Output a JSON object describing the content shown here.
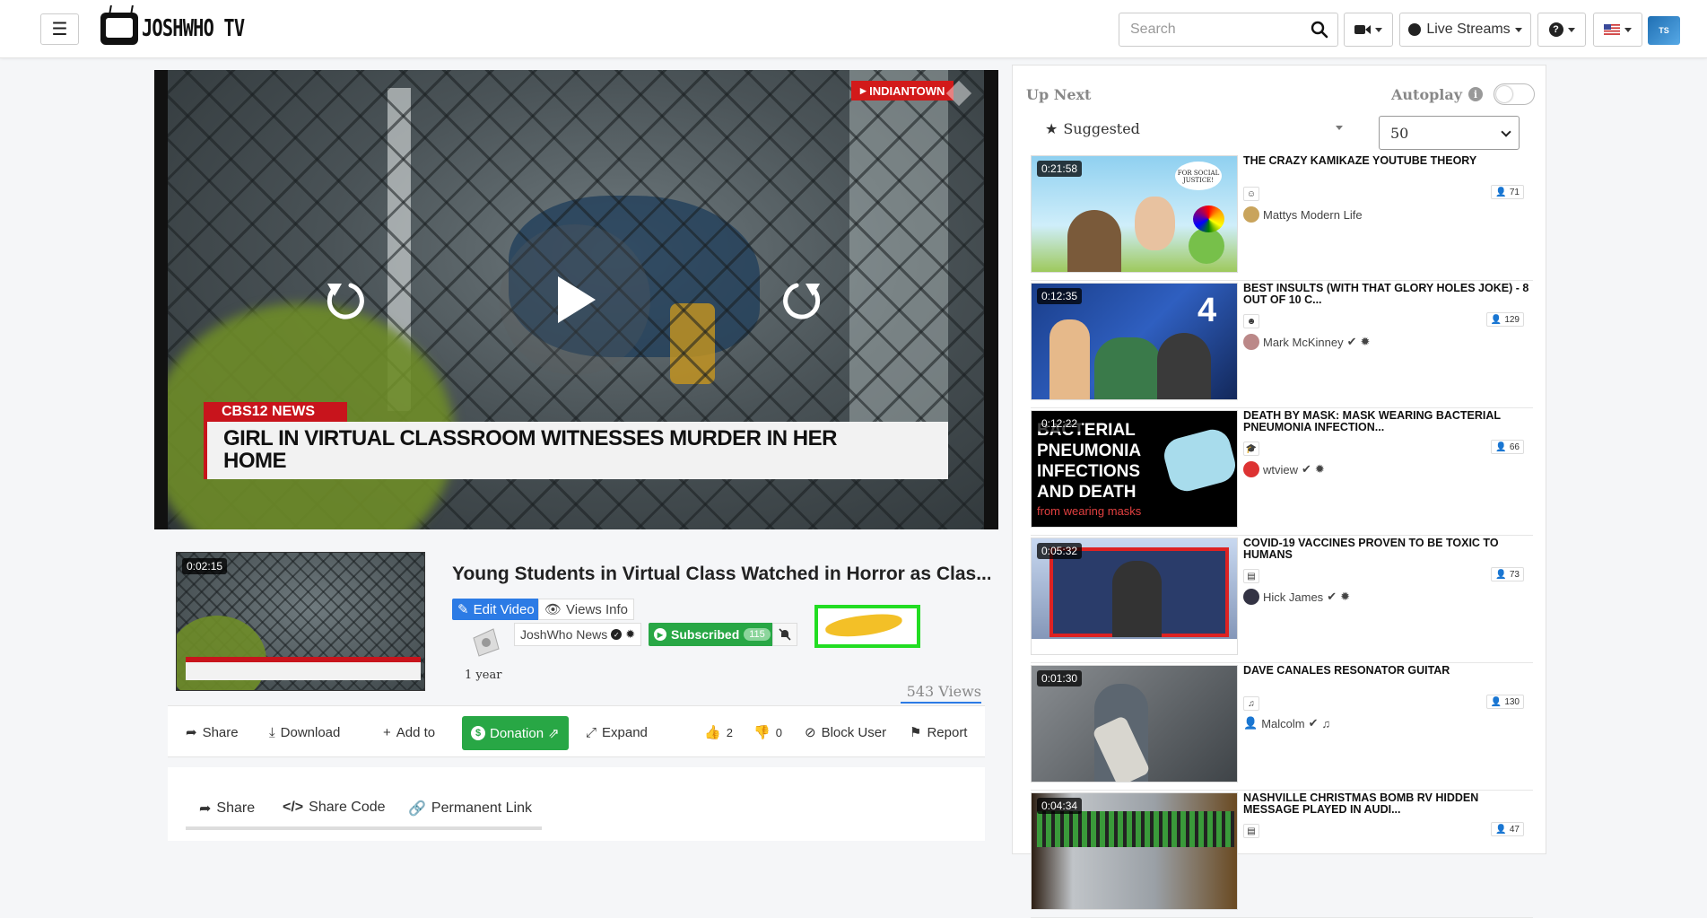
{
  "nav": {
    "search_placeholder": "Search",
    "live_streams": "Live Streams",
    "logo_text": "JOSHWHO TV"
  },
  "player": {
    "overlay_tag": "INDIANTOWN",
    "lower_third_brand": "CBS12 NEWS",
    "lower_third_headline": "GIRL IN VIRTUAL CLASSROOM WITNESSES MURDER IN HER HOME"
  },
  "video": {
    "duration": "0:02:15",
    "title": "Young Students in Virtual Class Watched in Horror as Clas...",
    "edit_label": "Edit Video",
    "views_info_label": "Views Info",
    "channel": "JoshWho News",
    "subscribed_label": "Subscribed",
    "subscriber_count": "115",
    "age": "1 year",
    "views": "543 Views"
  },
  "actions": {
    "share": "Share",
    "download": "Download",
    "add_to": "Add to",
    "donation": "Donation",
    "expand": "Expand",
    "likes": "2",
    "dislikes": "0",
    "block_user": "Block User",
    "report": "Report"
  },
  "share_tabs": {
    "share": "Share",
    "share_code": "Share Code",
    "permanent_link": "Permanent Link"
  },
  "sidebar": {
    "up_next": "Up Next",
    "autoplay": "Autoplay",
    "sort": "Suggested",
    "limit": "50",
    "items": [
      {
        "duration": "0:21:58",
        "title": "THE CRAZY KAMIKAZE YOUTUBE THEORY",
        "author": "Mattys Modern Life",
        "count": "71",
        "category": "laugh-icon"
      },
      {
        "duration": "0:12:35",
        "title": "BEST INSULTS (WITH THAT GLORY HOLES JOKE) - 8 OUT OF 10 C...",
        "author": "Mark McKinney",
        "count": "129",
        "category": "smile-icon"
      },
      {
        "duration": "0:12:22",
        "title": "DEATH BY MASK: MASK WEARING BACTERIAL PNEUMONIA INFECTION...",
        "author": "wtview",
        "count": "66",
        "category": "graduation-cap-icon"
      },
      {
        "duration": "0:05:32",
        "title": "COVID-19 VACCINES PROVEN TO BE TOXIC TO HUMANS",
        "author": "Hick James",
        "count": "73",
        "category": "newspaper-icon"
      },
      {
        "duration": "0:01:30",
        "title": "DAVE CANALES RESONATOR GUITAR",
        "author": "Malcolm",
        "count": "130",
        "category": "music-icon"
      },
      {
        "duration": "0:04:34",
        "title": "NASHVILLE CHRISTMAS BOMB RV HIDDEN MESSAGE PLAYED IN AUDI...",
        "author": "",
        "count": "47",
        "category": "newspaper-icon"
      }
    ],
    "thumb_texts": {
      "thumb3_text": "BACTERIAL PNEUMONIA INFECTIONS AND DEATH",
      "thumb3_sub": "from wearing masks",
      "thumb1_sign": "FOR SOCIAL JUSTICE!"
    }
  },
  "colors": {
    "primary": "#2c7be5",
    "success": "#28a745",
    "highlight": "#22dd22",
    "news_red": "#c8141c"
  }
}
